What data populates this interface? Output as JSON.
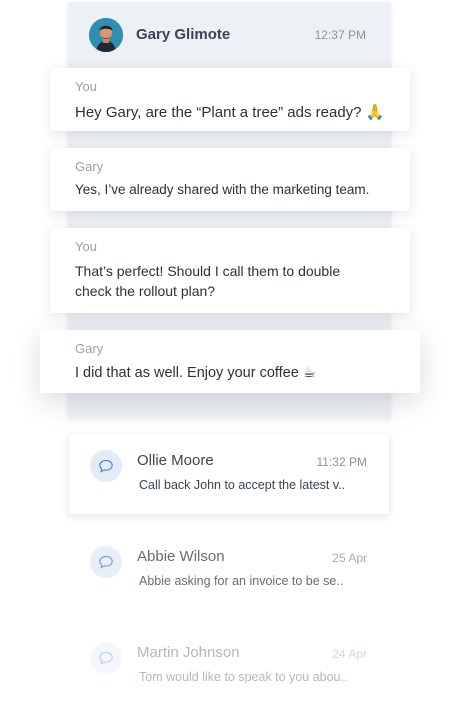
{
  "thread": {
    "contact_name": "Gary Glimote",
    "time": "12:37 PM",
    "messages": [
      {
        "sender": "You",
        "text": "Hey Gary, are the “Plant a tree” ads ready? 🙏"
      },
      {
        "sender": "Gary",
        "text": "Yes, I’ve already shared with the marketing team."
      },
      {
        "sender": "You",
        "text": "That’s perfect! Should I call them to double check the rollout plan?"
      },
      {
        "sender": "Gary",
        "text": "I did that as well. Enjoy your coffee ☕"
      }
    ]
  },
  "conversations": [
    {
      "name": "Ollie Moore",
      "time": "11:32 PM",
      "preview": "Call back John to accept the latest v.."
    },
    {
      "name": "Abbie Wilson",
      "time": "25 Apr",
      "preview": "Abbie asking for an invoice to be se.."
    },
    {
      "name": "Martin Johnson",
      "time": "24 Apr",
      "preview": "Tom would like to speak to you abou.."
    }
  ],
  "colors": {
    "accent": "#4a7bd4",
    "icon_bg": "#e4ebf8",
    "card_bg": "#edf0f4"
  },
  "icons": {
    "conversation": "chat-bubble-icon"
  }
}
